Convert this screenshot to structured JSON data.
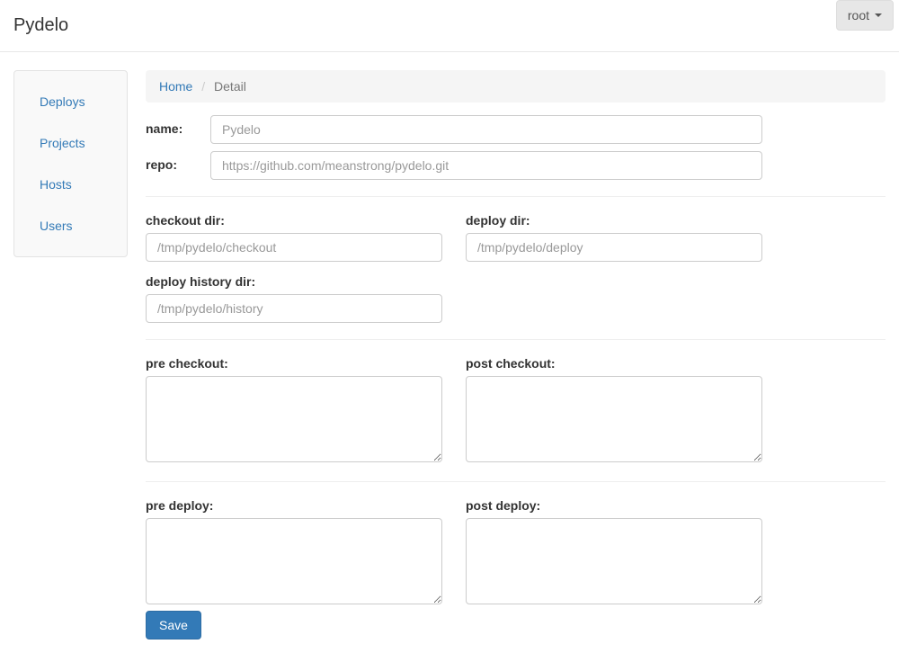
{
  "brand": "Pydelo",
  "user": {
    "name": "root"
  },
  "sidebar": {
    "items": [
      {
        "label": "Deploys"
      },
      {
        "label": "Projects"
      },
      {
        "label": "Hosts"
      },
      {
        "label": "Users"
      }
    ]
  },
  "breadcrumb": {
    "home": "Home",
    "current": "Detail"
  },
  "form": {
    "name_label": "name:",
    "name_placeholder": "Pydelo",
    "repo_label": "repo:",
    "repo_placeholder": "https://github.com/meanstrong/pydelo.git",
    "checkout_dir_label": "checkout dir:",
    "checkout_dir_placeholder": "/tmp/pydelo/checkout",
    "deploy_dir_label": "deploy dir:",
    "deploy_dir_placeholder": "/tmp/pydelo/deploy",
    "deploy_history_dir_label": "deploy history dir:",
    "deploy_history_dir_placeholder": "/tmp/pydelo/history",
    "pre_checkout_label": "pre checkout:",
    "post_checkout_label": "post checkout:",
    "pre_deploy_label": "pre deploy:",
    "post_deploy_label": "post deploy:",
    "save_label": "Save"
  }
}
